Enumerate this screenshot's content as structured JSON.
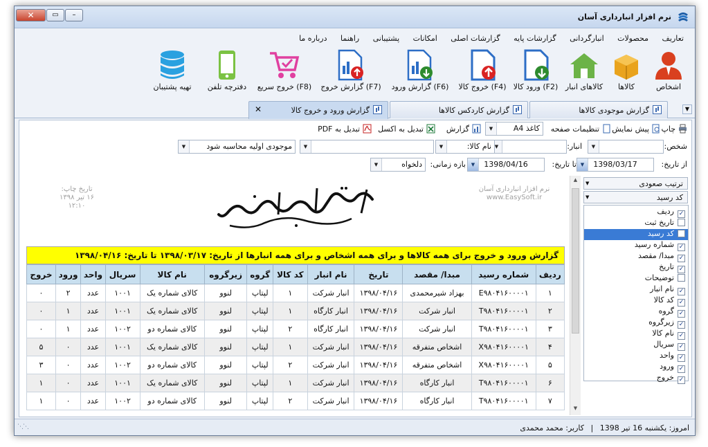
{
  "window": {
    "title": "نرم افزار انبارداری آسان"
  },
  "menu": [
    "تعاریف",
    "محصولات",
    "انبارگردانی",
    "گزارشات پایه",
    "گزارشات اصلی",
    "امکانات",
    "پشتیبانی",
    "راهنما",
    "درباره ما"
  ],
  "toolbar": [
    {
      "label": "اشخاص",
      "icon": "person-icon"
    },
    {
      "label": "کالاها",
      "icon": "box-icon"
    },
    {
      "label": "کالاهای انبار",
      "icon": "warehouse-icon"
    },
    {
      "label": "ورود کالا (F2)",
      "icon": "doc-in-icon"
    },
    {
      "label": "خروج کالا (F4)",
      "icon": "doc-out-icon"
    },
    {
      "label": "گزارش ورود (F6)",
      "icon": "report-in-icon"
    },
    {
      "label": "گزارش خروج (F7)",
      "icon": "report-out-icon"
    },
    {
      "label": "خروج سریع (F8)",
      "icon": "cart-icon"
    },
    {
      "label": "دفترچه تلفن",
      "icon": "phone-icon"
    },
    {
      "label": "تهیه پشتیبان",
      "icon": "database-icon"
    }
  ],
  "tabs": [
    {
      "label": "گزارش موجودی کالاها"
    },
    {
      "label": "گزارش کاردکس کالاها"
    },
    {
      "label": "گزارش ورود و خروج کالا"
    }
  ],
  "actions": {
    "print": "چاپ",
    "preview": "پیش نمایش",
    "page_setup": "تنظیمات صفحه",
    "paper": "کاغذ A4",
    "report": "گزارش",
    "to_excel": "تبدیل به اکسل",
    "to_pdf": "تبدیل به PDF"
  },
  "filters": {
    "person_label": "شخص:",
    "person_value": "",
    "warehouse_label": "انبار:",
    "warehouse_value": "",
    "goods_name_value": "نام کالا:",
    "goods_value": "",
    "inventory_value": "موجودی اولیه محاسبه شود",
    "from_label": "از تاریخ:",
    "from_value": "1398/03/17",
    "to_label": "تا تاریخ:",
    "to_value": "1398/04/16",
    "range_label": "بازه زمانی:",
    "range_value": "دلخواه"
  },
  "report": {
    "print_date_label": "تاریخ چاپ:",
    "print_date": "۱۶ تیر ۱۳۹۸",
    "print_time": "۱۲:۱۰",
    "software_name": "نرم افزار انبارداری آسان",
    "website": "www.EasySoft.ir",
    "company": "شرکت آسان سیستم بنا",
    "heading": "گزارش ورود و خروج برای همه کالاها و برای همه اشخاص و برای همه انبارها از تاریخ: ۱۳۹۸/۰۳/۱۷ تا تاریخ: ۱۳۹۸/۰۴/۱۶",
    "columns": [
      "ردیف",
      "شماره رسید",
      "مبدا/ مقصد",
      "تاریخ",
      "نام انبار",
      "کد کالا",
      "گروه",
      "زیرگروه",
      "نام کالا",
      "سریال",
      "واحد",
      "ورود",
      "خروج"
    ],
    "rows": [
      [
        "۱",
        "E۹۸۰۴۱۶۰۰۰۰۱",
        "بهزاد شیرمحمدی",
        "۱۳۹۸/۰۴/۱۶",
        "انبار شرکت",
        "۱",
        "لپتاپ",
        "لنوو",
        "کالای شماره یک",
        "۱۰۰۱",
        "عدد",
        "۲",
        "۰"
      ],
      [
        "۲",
        "T۹۸۰۴۱۶۰۰۰۰۱",
        "انبار شرکت",
        "۱۳۹۸/۰۴/۱۶",
        "انبار کارگاه",
        "۱",
        "لپتاپ",
        "لنوو",
        "کالای شماره یک",
        "۱۰۰۱",
        "عدد",
        "۱",
        "۰"
      ],
      [
        "۳",
        "T۹۸۰۴۱۶۰۰۰۰۱",
        "انبار شرکت",
        "۱۳۹۸/۰۴/۱۶",
        "انبار کارگاه",
        "۲",
        "لپتاپ",
        "لنوو",
        "کالای شماره دو",
        "۱۰۰۲",
        "عدد",
        "۱",
        "۰"
      ],
      [
        "۴",
        "X۹۸۰۴۱۶۰۰۰۰۱",
        "اشخاص متفرقه",
        "۱۳۹۸/۰۴/۱۶",
        "انبار شرکت",
        "۱",
        "لپتاپ",
        "لنوو",
        "کالای شماره یک",
        "۱۰۰۱",
        "عدد",
        "۰",
        "۵"
      ],
      [
        "۵",
        "X۹۸۰۴۱۶۰۰۰۰۱",
        "اشخاص متفرقه",
        "۱۳۹۸/۰۴/۱۶",
        "انبار شرکت",
        "۲",
        "لپتاپ",
        "لنوو",
        "کالای شماره دو",
        "۱۰۰۲",
        "عدد",
        "۰",
        "۳"
      ],
      [
        "۶",
        "T۹۸۰۴۱۶۰۰۰۰۱",
        "انبار کارگاه",
        "۱۳۹۸/۰۴/۱۶",
        "انبار شرکت",
        "۱",
        "لپتاپ",
        "لنوو",
        "کالای شماره یک",
        "۱۰۰۱",
        "عدد",
        "۰",
        "۱"
      ],
      [
        "۷",
        "T۹۸۰۴۱۶۰۰۰۰۱",
        "انبار کارگاه",
        "۱۳۹۸/۰۴/۱۶",
        "انبار شرکت",
        "۲",
        "لپتاپ",
        "لنوو",
        "کالای شماره دو",
        "۱۰۰۲",
        "عدد",
        "۰",
        "۱"
      ]
    ]
  },
  "columns_panel": {
    "sort_order": "ترتیب صعودی",
    "sort_by": "کد رسید",
    "items": [
      {
        "label": "ردیف",
        "checked": true
      },
      {
        "label": "تاریخ ثبت",
        "checked": false
      },
      {
        "label": "کد رسید",
        "checked": false,
        "selected": true
      },
      {
        "label": "شماره رسید",
        "checked": true
      },
      {
        "label": "مبدا/ مقصد",
        "checked": true
      },
      {
        "label": "تاریخ",
        "checked": true
      },
      {
        "label": "توضیحات",
        "checked": false
      },
      {
        "label": "نام انبار",
        "checked": true
      },
      {
        "label": "کد کالا",
        "checked": true
      },
      {
        "label": "گروه",
        "checked": true
      },
      {
        "label": "زیرگروه",
        "checked": true
      },
      {
        "label": "نام کالا",
        "checked": true
      },
      {
        "label": "سریال",
        "checked": true
      },
      {
        "label": "واحد",
        "checked": true
      },
      {
        "label": "ورود",
        "checked": true
      },
      {
        "label": "خروج",
        "checked": true
      }
    ]
  },
  "status": {
    "today": "امروز: یکشنبه 16 تیر 1398",
    "separator": "|",
    "user": "کاربر: محمد محمدی"
  }
}
